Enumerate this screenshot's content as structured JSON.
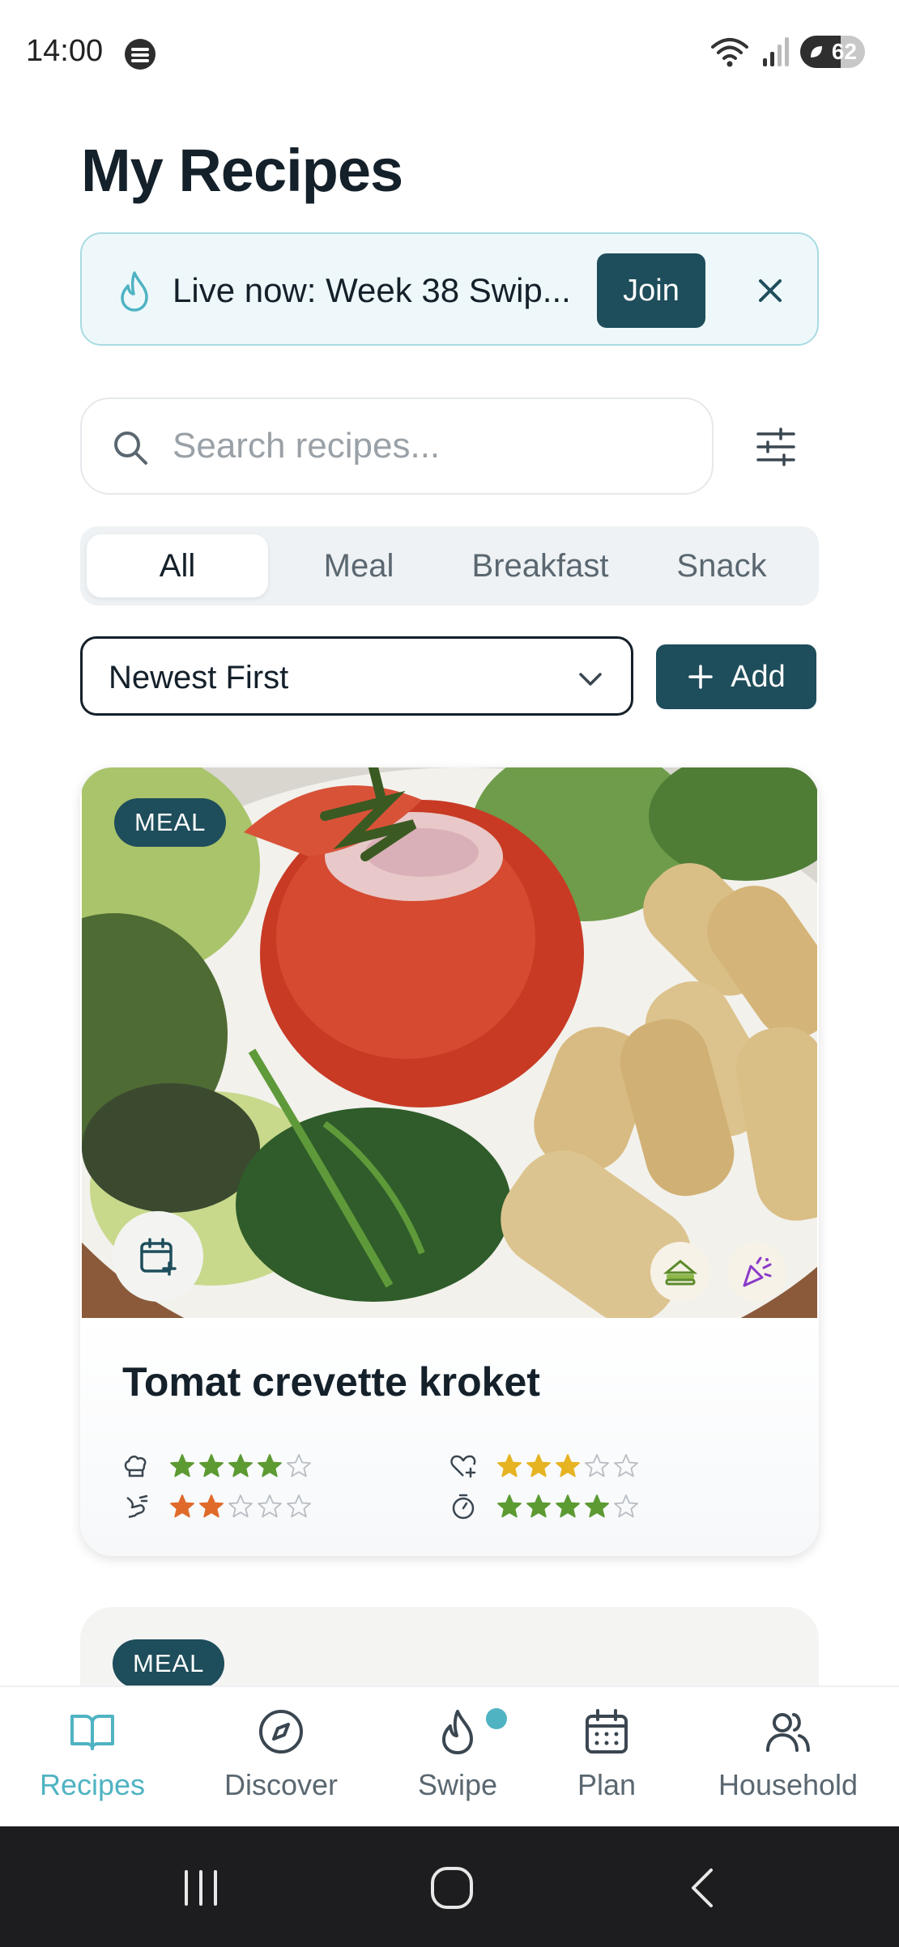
{
  "status_bar": {
    "time": "14:00",
    "battery": "62",
    "battery_level": 0.62,
    "icons": [
      "spotify-icon",
      "wifi-icon",
      "signal-icon",
      "battery-icon"
    ]
  },
  "page_title": "My Recipes",
  "banner": {
    "text": "Live now: Week 38 Swip...",
    "join_label": "Join",
    "icons": [
      "flame-icon",
      "close-icon"
    ]
  },
  "search": {
    "placeholder": "Search recipes..."
  },
  "tabs": [
    {
      "label": "All",
      "active": true
    },
    {
      "label": "Meal",
      "active": false
    },
    {
      "label": "Breakfast",
      "active": false
    },
    {
      "label": "Snack",
      "active": false
    }
  ],
  "sort": {
    "selected": "Newest First"
  },
  "add_label": "Add",
  "colors": {
    "primary": "#1e4d5b",
    "accent": "#4fb3c2",
    "star_green": "#5c9a32",
    "star_yellow": "#e6b322",
    "star_orange": "#e06a2a"
  },
  "recipes": [
    {
      "badge": "MEAL",
      "title": "Tomat crevette kroket",
      "ratings": [
        {
          "icon": "chef-hat-icon",
          "value": 4,
          "color": "green"
        },
        {
          "icon": "heart-plus-icon",
          "value": 3,
          "color": "yellow"
        },
        {
          "icon": "effort-icon",
          "value": 2,
          "color": "orange"
        },
        {
          "icon": "timer-icon",
          "value": 4,
          "color": "green"
        }
      ],
      "tags": [
        "sandwich-icon",
        "party-icon"
      ]
    },
    {
      "badge": "MEAL"
    }
  ],
  "bottom_nav": [
    {
      "label": "Recipes",
      "icon": "book-open-icon",
      "active": true
    },
    {
      "label": "Discover",
      "icon": "compass-icon",
      "active": false
    },
    {
      "label": "Swipe",
      "icon": "flame-icon",
      "active": false,
      "dot": true
    },
    {
      "label": "Plan",
      "icon": "calendar-icon",
      "active": false
    },
    {
      "label": "Household",
      "icon": "users-icon",
      "active": false
    }
  ]
}
